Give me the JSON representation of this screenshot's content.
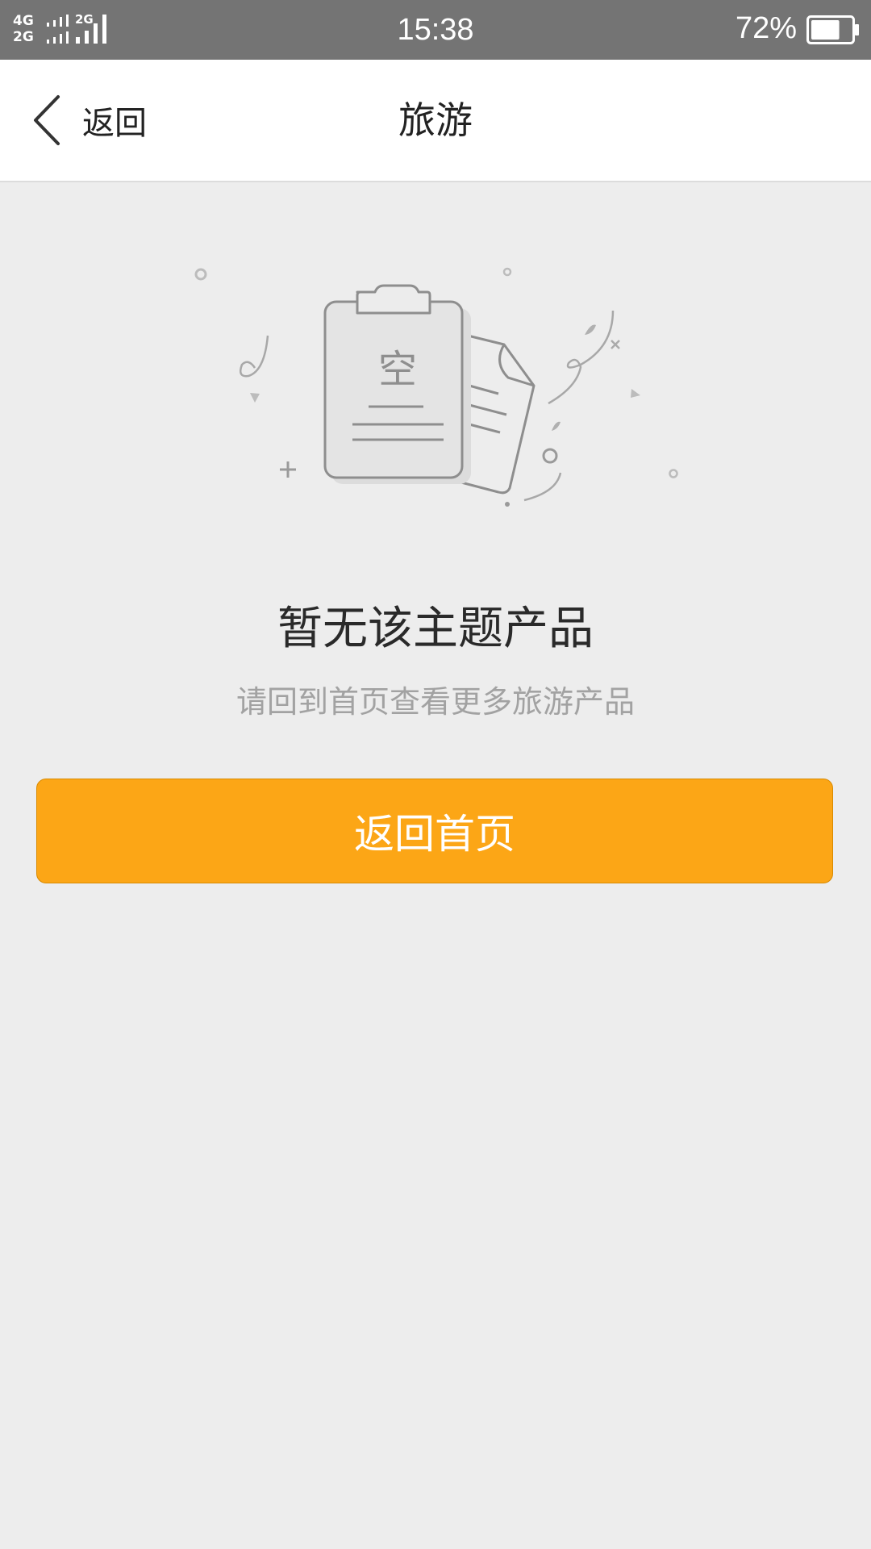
{
  "status_bar": {
    "network_top": "4G",
    "network_bottom": "2G",
    "network_secondary": "2G",
    "time": "15:38",
    "battery_percent": "72%",
    "battery_level": 0.72
  },
  "nav": {
    "back_label": "返回",
    "title": "旅游"
  },
  "illustration": {
    "clipboard_char": "空"
  },
  "empty_state": {
    "title": "暂无该主题产品",
    "subtitle": "请回到首页查看更多旅游产品"
  },
  "actions": {
    "home_button_label": "返回首页"
  },
  "colors": {
    "status_bar_bg": "#747474",
    "page_bg": "#ededed",
    "accent": "#fca616"
  }
}
